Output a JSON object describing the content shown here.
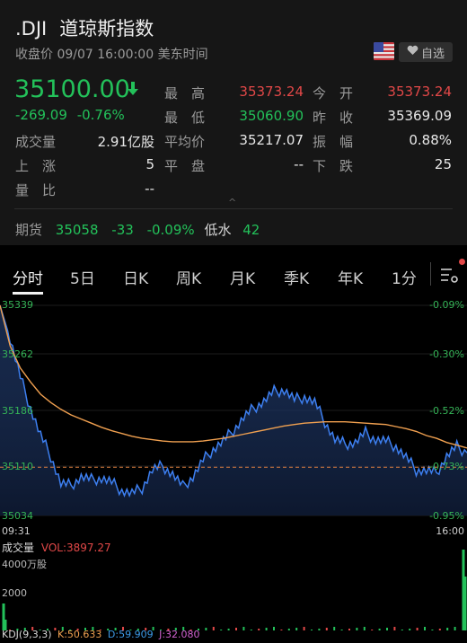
{
  "header": {
    "symbol": ".DJI",
    "name": "道琼斯指数",
    "status": "收盘价 09/07 16:00:00 美东时间",
    "watch_label": "自选"
  },
  "quote": {
    "price": "35100.00",
    "change": "-269.09",
    "change_pct": "-0.76%",
    "direction": "down"
  },
  "stats": [
    {
      "label": "最　高",
      "value": "35373.24",
      "color": "red"
    },
    {
      "label": "今　开",
      "value": "35373.24",
      "color": "red"
    },
    {
      "label": "成交量",
      "value": "2.91亿股",
      "color": "white"
    },
    {
      "label": "最　低",
      "value": "35060.90",
      "color": "green"
    },
    {
      "label": "昨　收",
      "value": "35369.09",
      "color": "white"
    },
    {
      "label": "平均价",
      "value": "35217.07",
      "color": "white"
    },
    {
      "label": "振　幅",
      "value": "0.88%",
      "color": "white"
    },
    {
      "label": "上　涨",
      "value": "5",
      "color": "white"
    },
    {
      "label": "平　盘",
      "value": "--",
      "color": "white"
    },
    {
      "label": "下　跌",
      "value": "25",
      "color": "white"
    },
    {
      "label": "量　比",
      "value": "--",
      "color": "white"
    }
  ],
  "futures": {
    "label": "期货",
    "price": "35058",
    "change": "-33",
    "change_pct": "-0.09%",
    "basis_label": "低水",
    "basis": "42"
  },
  "tabs": [
    "分时",
    "5日",
    "日K",
    "周K",
    "月K",
    "季K",
    "年K",
    "1分"
  ],
  "active_tab": "分时",
  "colors": {
    "up": "#e24848",
    "down": "#23c15a",
    "price_line": "#3d7ff0",
    "avg_line": "#f0a050",
    "background": "#000000"
  },
  "icons": [
    "arrow-down-icon",
    "us-flag-icon",
    "heart-icon",
    "chart-settings-icon"
  ],
  "chart_data": {
    "type": "line",
    "y_left_ticks": [
      "35339",
      "35262",
      "35186",
      "35110",
      "35034"
    ],
    "y_right_ticks": [
      "-0.09%",
      "-0.30%",
      "-0.52%",
      "-0.73%",
      "-0.95%"
    ],
    "x_ticks": [
      "09:31",
      "16:00"
    ],
    "ylim": [
      35034,
      35339
    ],
    "prev_close": 35369.09,
    "series": [
      {
        "values": [
          35339,
          35290,
          35235,
          35190,
          35150,
          35120,
          35080,
          35078,
          35090,
          35086,
          35088,
          35082,
          35070,
          35066,
          35074,
          35100,
          35106,
          35094,
          35076,
          35090,
          35114,
          35130,
          35142,
          35158,
          35176,
          35190,
          35200,
          35214,
          35216,
          35202,
          35206,
          35198,
          35170,
          35144,
          35138,
          35140,
          35154,
          35144,
          35142,
          35134,
          35118,
          35100,
          35099,
          35096,
          35120,
          35134,
          35125
        ]
      },
      {
        "values": [
          35339,
          35280,
          35248,
          35228,
          35210,
          35198,
          35188,
          35180,
          35174,
          35168,
          35162,
          35157,
          35153,
          35149,
          35146,
          35144,
          35142,
          35141,
          35141,
          35141,
          35142,
          35144,
          35146,
          35149,
          35152,
          35155,
          35158,
          35161,
          35164,
          35166,
          35168,
          35169,
          35170,
          35170,
          35170,
          35169,
          35168,
          35167,
          35166,
          35163,
          35160,
          35156,
          35150,
          35146,
          35140,
          35136,
          35132
        ]
      }
    ]
  },
  "volume": {
    "label": "成交量",
    "vol": "VOL:3897.27",
    "ticks": [
      "4000万股",
      "2000"
    ]
  },
  "kdj": {
    "label": "KDJ(9,3,3)",
    "k": "K:50.633",
    "d": "D:59.909",
    "j": "J:32.080"
  }
}
